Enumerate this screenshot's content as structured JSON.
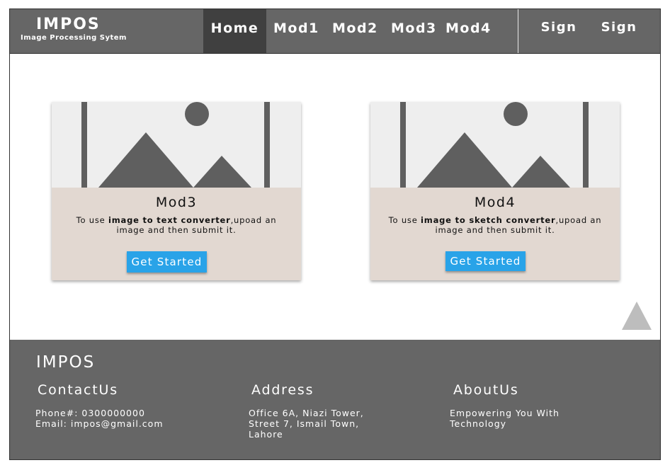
{
  "header": {
    "brand": "IMPOS",
    "tagline": "Image Processing Sytem",
    "nav": [
      "Home",
      "Mod1",
      "Mod2",
      "Mod3",
      "Mod4"
    ],
    "active": "Home",
    "sign_in": "Sign In",
    "sign_up": "Sign Up"
  },
  "cards": [
    {
      "title": "Mod3",
      "desc_prefix": "To use ",
      "desc_bold": "image to text converter",
      "desc_suffix": ",upoad an image and then submit it.",
      "button": "Get Started"
    },
    {
      "title": "Mod4",
      "desc_prefix": "To use ",
      "desc_bold": "image to sketch converter",
      "desc_suffix": ",upoad an image and then submit it.",
      "button": "Get Started"
    }
  ],
  "footer": {
    "brand": "IMPOS",
    "contact": {
      "heading": "ContactUs",
      "phone": "Phone#: 0300000000",
      "email": "Email: impos@gmail.com"
    },
    "address": {
      "heading": "Address",
      "lines": [
        "Office 6A, Niazi Tower,",
        "Street 7, Ismail Town,",
        "Lahore"
      ]
    },
    "about": {
      "heading": "AboutUs",
      "lines": [
        "Empowering You With",
        "Technology"
      ]
    }
  },
  "colors": {
    "header_bg": "#666666",
    "active_nav_bg": "#404040",
    "card_bg": "#e2d8d1",
    "button_bg": "#29a3e8",
    "scroll_top": "#bdbdbd"
  },
  "icons": {
    "scroll_top": "triangle-up-icon",
    "card_image": "image-placeholder-icon"
  }
}
